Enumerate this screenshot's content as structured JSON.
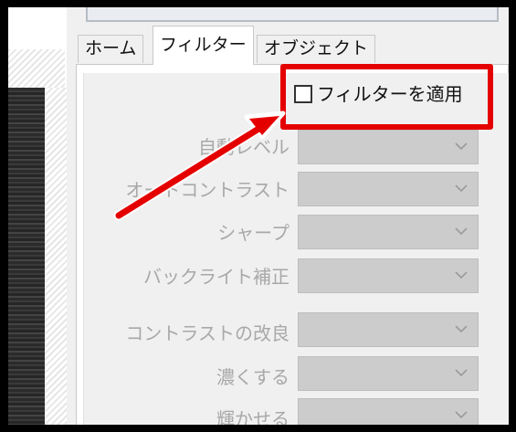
{
  "tabs": [
    {
      "label": "ホーム",
      "active": false
    },
    {
      "label": "フィルター",
      "active": true
    },
    {
      "label": "オブジェクト",
      "active": false
    }
  ],
  "filter": {
    "apply_label": "フィルターを適用",
    "apply_checked": false
  },
  "rows": [
    {
      "label": "自動レベル"
    },
    {
      "label": "オートコントラスト"
    },
    {
      "label": "シャープ"
    },
    {
      "label": "バックライト補正"
    },
    {
      "label": "コントラストの改良"
    },
    {
      "label": "濃くする"
    },
    {
      "label": "輝かせる"
    }
  ],
  "colors": {
    "highlight": "#e50000",
    "disabled_text": "#a8a8a8",
    "select_bg": "#cccccc"
  },
  "icons": {
    "dropdown": "chevron-down-icon",
    "checkbox": "checkbox-icon"
  }
}
